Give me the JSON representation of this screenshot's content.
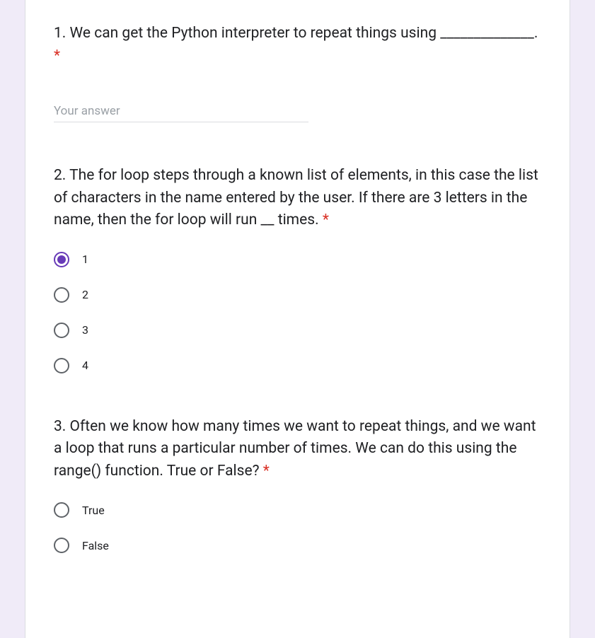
{
  "q1": {
    "title": "1. We can get the Python interpreter to repeat things using ______________.",
    "required": "*",
    "placeholder": "Your answer"
  },
  "q2": {
    "title": "2. The for loop steps through a known list of elements, in this case the list of characters in the name entered by the user. If there are 3 letters in the name, then the for loop will run __ times.",
    "required": "*",
    "options": [
      "1",
      "2",
      "3",
      "4"
    ],
    "selectedIndex": 0
  },
  "q3": {
    "title": "3. Often we know how many times we want to repeat things, and we want a loop that runs a particular number of times. We can do this using the range() function. True or False?",
    "required": "*",
    "options": [
      "True",
      "False"
    ],
    "selectedIndex": -1
  }
}
